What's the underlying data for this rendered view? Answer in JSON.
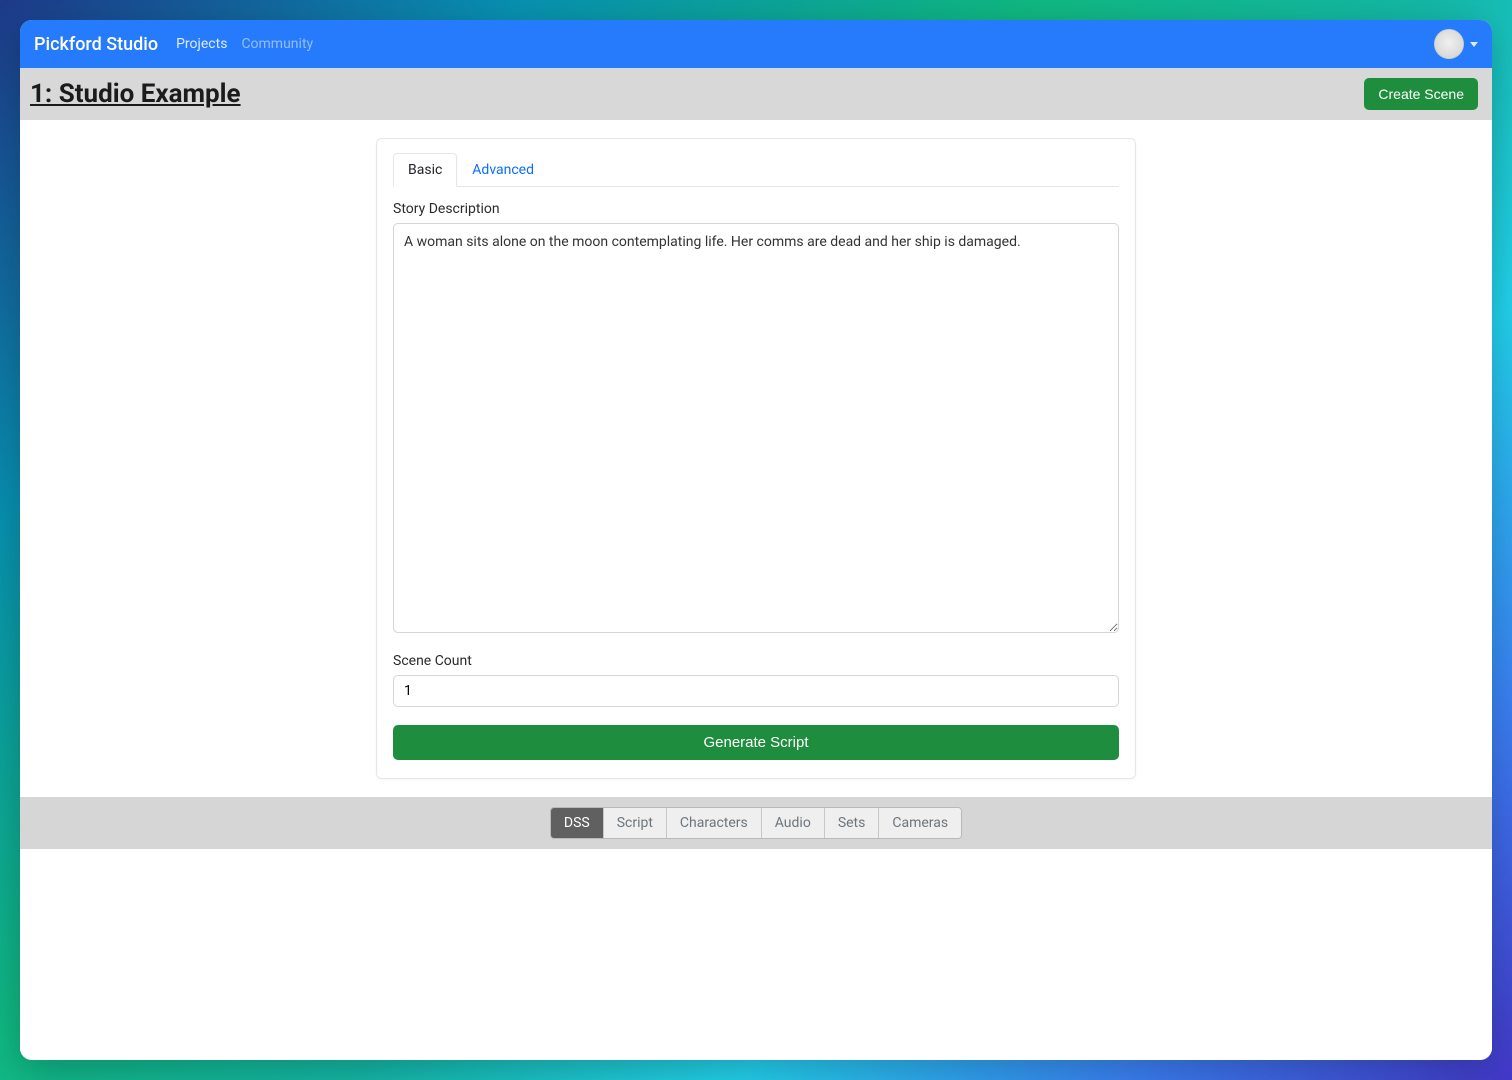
{
  "header": {
    "brand": "Pickford Studio",
    "nav": [
      {
        "label": "Projects",
        "muted": false
      },
      {
        "label": "Community",
        "muted": true
      }
    ]
  },
  "subheader": {
    "title": "1: Studio Example",
    "create_scene_label": "Create Scene"
  },
  "card": {
    "tabs": [
      {
        "label": "Basic",
        "active": true
      },
      {
        "label": "Advanced",
        "active": false
      }
    ],
    "story_label": "Story Description",
    "story_value": "A woman sits alone on the moon contemplating life. Her comms are dead and her ship is damaged.",
    "scene_count_label": "Scene Count",
    "scene_count_value": "1",
    "generate_label": "Generate Script"
  },
  "bottom_tabs": [
    {
      "label": "DSS",
      "active": true
    },
    {
      "label": "Script",
      "active": false
    },
    {
      "label": "Characters",
      "active": false
    },
    {
      "label": "Audio",
      "active": false
    },
    {
      "label": "Sets",
      "active": false
    },
    {
      "label": "Cameras",
      "active": false
    }
  ]
}
